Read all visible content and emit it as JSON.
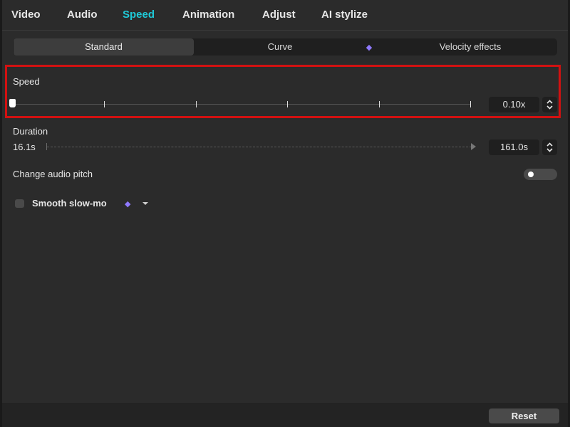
{
  "tabs": [
    {
      "label": "Video"
    },
    {
      "label": "Audio"
    },
    {
      "label": "Speed",
      "active": true
    },
    {
      "label": "Animation"
    },
    {
      "label": "Adjust"
    },
    {
      "label": "AI stylize"
    }
  ],
  "speed_modes": {
    "standard": "Standard",
    "curve": "Curve",
    "velocity": "Velocity effects",
    "velocity_icon": "gem-icon"
  },
  "speed": {
    "label": "Speed",
    "value": "0.10x",
    "slider_level": 0.0,
    "tick_count": 6
  },
  "duration": {
    "label": "Duration",
    "original": "16.1s",
    "value": "161.0s"
  },
  "audio_pitch": {
    "label": "Change audio pitch",
    "enabled": false
  },
  "smooth_slowmo": {
    "label": "Smooth slow-mo",
    "checked": false,
    "icon": "gem-icon"
  },
  "footer": {
    "reset_label": "Reset"
  },
  "colors": {
    "accent": "#1fc8d6",
    "highlight": "#d21111",
    "gem": "#8f79ff",
    "panel": "#2b2b2b"
  }
}
